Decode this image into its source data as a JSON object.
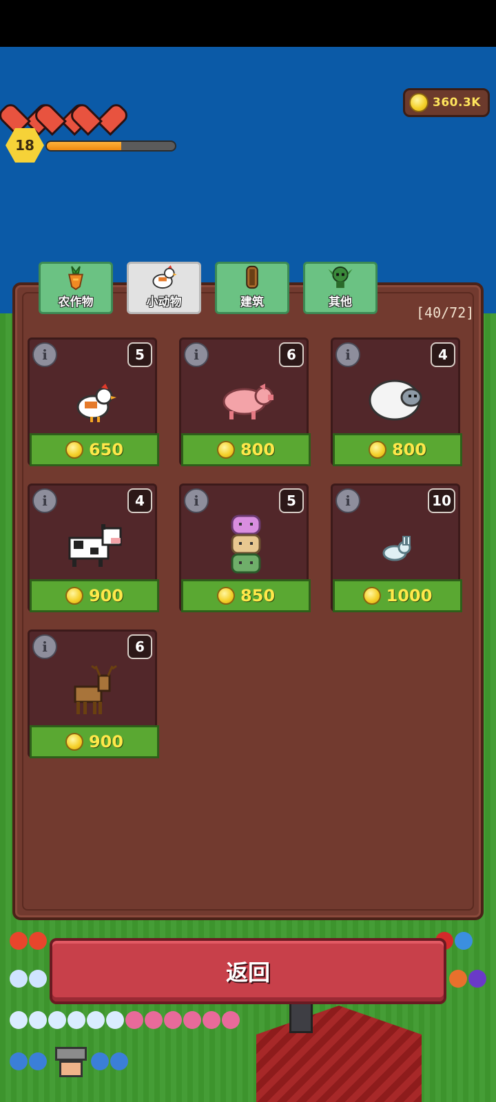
{
  "hud": {
    "hearts": 3,
    "level": "18",
    "xp_progress": 0.58,
    "coins": "360.3K"
  },
  "tabs": [
    {
      "label": "农作物",
      "icon": "carrot-icon",
      "active": false
    },
    {
      "label": "小动物",
      "icon": "chicken-icon",
      "active": true
    },
    {
      "label": "建筑",
      "icon": "wood-log-icon",
      "active": false
    },
    {
      "label": "其他",
      "icon": "goblin-icon",
      "active": false
    }
  ],
  "counter": "[40/72]",
  "items": [
    {
      "animal": "chicken",
      "qty": "5",
      "price": "650"
    },
    {
      "animal": "pig",
      "qty": "6",
      "price": "800"
    },
    {
      "animal": "sheep",
      "qty": "4",
      "price": "800"
    },
    {
      "animal": "cow",
      "qty": "4",
      "price": "900"
    },
    {
      "animal": "slime-stack",
      "qty": "5",
      "price": "850"
    },
    {
      "animal": "rabbit",
      "qty": "10",
      "price": "1000"
    },
    {
      "animal": "deer",
      "qty": "6",
      "price": "900"
    }
  ],
  "info_glyph": "i",
  "return_label": "返回",
  "colors": {
    "panel": "#723a2f",
    "tab_active": "#e2e2e2",
    "tab_inactive": "#6bc283",
    "price_button": "#5aa832",
    "return_button": "#c8404a"
  }
}
